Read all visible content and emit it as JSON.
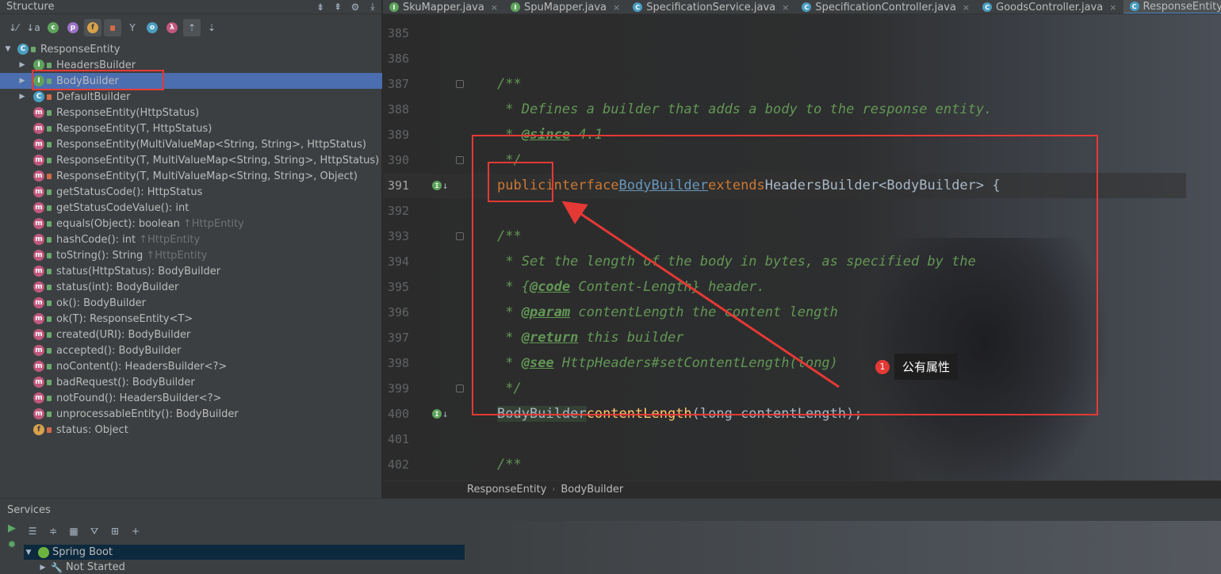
{
  "structure": {
    "title": "Structure",
    "root": "ResponseEntity",
    "items": [
      {
        "kind": "i",
        "lock": "g",
        "label": "HeadersBuilder",
        "expandable": true
      },
      {
        "kind": "i",
        "lock": "g",
        "label": "BodyBuilder",
        "expandable": true,
        "selected": true
      },
      {
        "kind": "c",
        "lock": "r",
        "label": "DefaultBuilder",
        "expandable": true
      },
      {
        "kind": "m",
        "lock": "g",
        "label": "ResponseEntity(HttpStatus)"
      },
      {
        "kind": "m",
        "lock": "g",
        "label": "ResponseEntity(T, HttpStatus)"
      },
      {
        "kind": "m",
        "lock": "g",
        "label": "ResponseEntity(MultiValueMap<String, String>, HttpStatus)"
      },
      {
        "kind": "m",
        "lock": "g",
        "label": "ResponseEntity(T, MultiValueMap<String, String>, HttpStatus)"
      },
      {
        "kind": "m",
        "lock": "r",
        "label": "ResponseEntity(T, MultiValueMap<String, String>, Object)"
      },
      {
        "kind": "m",
        "lock": "g",
        "label": "getStatusCode(): HttpStatus"
      },
      {
        "kind": "m",
        "lock": "g",
        "label": "getStatusCodeValue(): int"
      },
      {
        "kind": "m",
        "lock": "g",
        "label": "equals(Object): boolean",
        "inherited": "↑HttpEntity"
      },
      {
        "kind": "m",
        "lock": "g",
        "label": "hashCode(): int",
        "inherited": "↑HttpEntity"
      },
      {
        "kind": "m",
        "lock": "g",
        "label": "toString(): String",
        "inherited": "↑HttpEntity"
      },
      {
        "kind": "m",
        "lock": "g",
        "label": "status(HttpStatus): BodyBuilder"
      },
      {
        "kind": "m",
        "lock": "g",
        "label": "status(int): BodyBuilder"
      },
      {
        "kind": "m",
        "lock": "g",
        "label": "ok(): BodyBuilder"
      },
      {
        "kind": "m",
        "lock": "g",
        "label": "ok(T): ResponseEntity<T>"
      },
      {
        "kind": "m",
        "lock": "g",
        "label": "created(URI): BodyBuilder"
      },
      {
        "kind": "m",
        "lock": "g",
        "label": "accepted(): BodyBuilder"
      },
      {
        "kind": "m",
        "lock": "g",
        "label": "noContent(): HeadersBuilder<?>"
      },
      {
        "kind": "m",
        "lock": "g",
        "label": "badRequest(): BodyBuilder"
      },
      {
        "kind": "m",
        "lock": "g",
        "label": "notFound(): HeadersBuilder<?>"
      },
      {
        "kind": "m",
        "lock": "g",
        "label": "unprocessableEntity(): BodyBuilder"
      },
      {
        "kind": "f",
        "lock": "r",
        "label": "status: Object"
      }
    ]
  },
  "tabs": [
    {
      "label": "SkuMapper.java",
      "icon": "interface-icon"
    },
    {
      "label": "SpuMapper.java",
      "icon": "interface-icon"
    },
    {
      "label": "SpecificationService.java",
      "icon": "class-icon"
    },
    {
      "label": "SpecificationController.java",
      "icon": "class-icon"
    },
    {
      "label": "GoodsController.java",
      "icon": "class-icon"
    },
    {
      "label": "ResponseEntity.java",
      "icon": "class-icon",
      "active": true
    }
  ],
  "line_numbers": [
    "385",
    "386",
    "387",
    "388",
    "389",
    "390",
    "391",
    "392",
    "393",
    "394",
    "395",
    "396",
    "397",
    "398",
    "399",
    "400",
    "401",
    "402"
  ],
  "code": {
    "l387": "/**",
    "l388": " * Defines a builder that adds a body to the response entity.",
    "l389_pre": " * ",
    "l389_tag": "@since",
    "l389_rest": " 4.1",
    "l390": " */",
    "l391_public": "public",
    "l391_interface": "interface",
    "l391_name": "BodyBuilder",
    "l391_extends": "extends",
    "l391_rest": "HeadersBuilder<BodyBuilder> {",
    "l393": "/**",
    "l394": " * Set the length of the body in bytes, as specified by the",
    "l395_pre": " * {",
    "l395_tag": "@code",
    "l395_rest": " Content-Length} header.",
    "l396_pre": " * ",
    "l396_tag": "@param",
    "l396_rest": " contentLength the content length",
    "l397_pre": " * ",
    "l397_tag": "@return",
    "l397_rest": " this builder",
    "l398_pre": " * ",
    "l398_tag": "@see",
    "l398_rest": " HttpHeaders#setContentLength(long)",
    "l399": " */",
    "l400_type": "BodyBuilder",
    "l400_method": "contentLength",
    "l400_rest": "(long contentLength);",
    "l402": "/**"
  },
  "breadcrumb": [
    "ResponseEntity",
    "BodyBuilder"
  ],
  "annotation": {
    "badge": "1",
    "text": "公有属性"
  },
  "services": {
    "title": "Services",
    "tree": [
      {
        "label": "Spring Boot",
        "icon": "spring-boot-icon"
      },
      {
        "label": "Not Started",
        "icon": "wrench-icon"
      }
    ]
  },
  "colors": {
    "highlight": "#e53935",
    "selection": "#4b6eaf",
    "keyword": "#cc7832",
    "doc": "#629755"
  }
}
